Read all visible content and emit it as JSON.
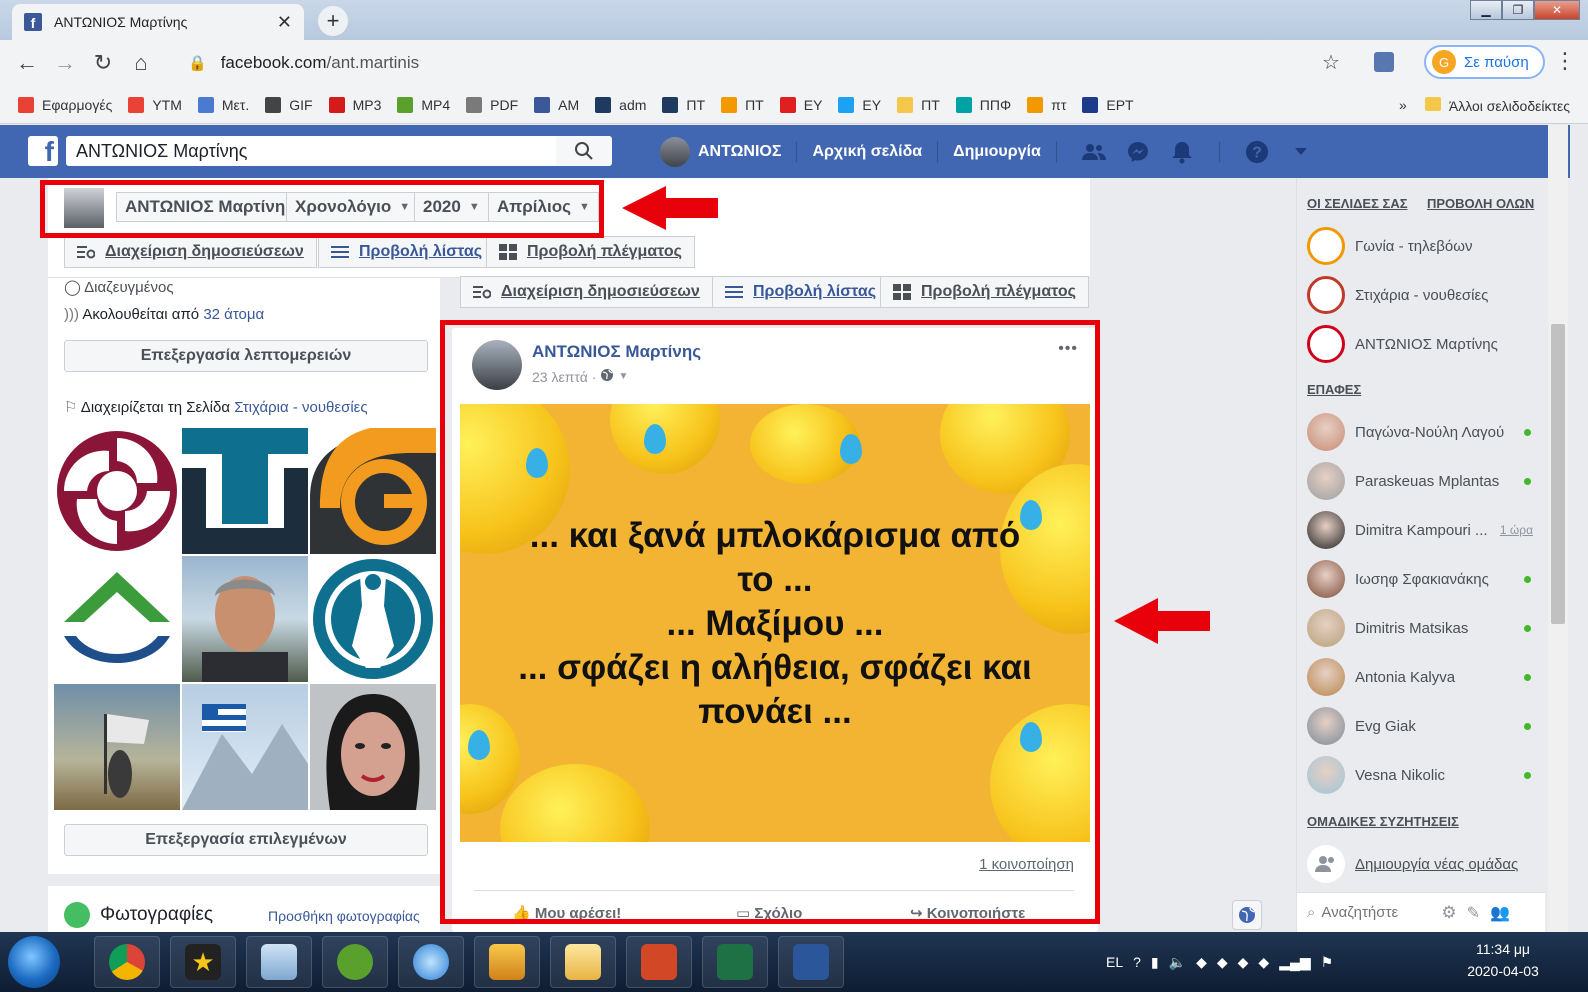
{
  "browser": {
    "tab_title": "ΑΝΤΩΝΙΟΣ Μαρτίνης",
    "url_host": "facebook.com",
    "url_path": "/ant.martinis",
    "profile_status": "Σε παύση",
    "bookmarks": [
      {
        "label": "Εφαρμογές",
        "color": "#e94235"
      },
      {
        "label": "YTM",
        "color": "#ea4335"
      },
      {
        "label": "Μετ.",
        "color": "#4a7bd0"
      },
      {
        "label": "GIF",
        "color": "#444444"
      },
      {
        "label": "MP3",
        "color": "#d41a1a"
      },
      {
        "label": "MP4",
        "color": "#5aa02c"
      },
      {
        "label": "PDF",
        "color": "#7a7a7a"
      },
      {
        "label": "AM",
        "color": "#3b5998"
      },
      {
        "label": "adm",
        "color": "#1e3a5f"
      },
      {
        "label": "ΠΤ",
        "color": "#1e3a5f"
      },
      {
        "label": "ΠΤ",
        "color": "#f29900"
      },
      {
        "label": "ΕΥ",
        "color": "#e02020"
      },
      {
        "label": "ΕΥ",
        "color": "#1da1f2"
      },
      {
        "label": "ΠΤ",
        "color": "#f3c84b"
      },
      {
        "label": "ΠΠΦ",
        "color": "#00a3a3"
      },
      {
        "label": "πτ",
        "color": "#f29900"
      },
      {
        "label": "ΕΡΤ",
        "color": "#1e3a8a"
      }
    ],
    "bookmarks_more": "»",
    "other_bookmarks": "Άλλοι σελιδοδείκτες"
  },
  "fb": {
    "search_value": "ΑΝΤΩΝΙΟΣ Μαρτίνης",
    "user_name": "ΑΝΤΩΝΙΟΣ",
    "home": "Αρχική σελίδα",
    "create": "Δημιουργία"
  },
  "timeline_header": {
    "name": "ΑΝΤΩΝΙΟΣ Μαρτίνης",
    "timeline": "Χρονολόγιο",
    "year": "2020",
    "month": "Απρίλιος",
    "manage_posts": "Διαχείριση δημοσιεύσεων",
    "list_view": "Προβολή λίστας",
    "grid_view": "Προβολή πλέγματος"
  },
  "left": {
    "status": "Διαζευγμένος",
    "followed_prefix": "Ακολουθείται από",
    "followed_link": "32 άτομα",
    "edit_details": "Επεξεργασία λεπτομερειών",
    "manages_prefix": "Διαχειρίζεται τη Σελίδα",
    "manages_link": "Στιχάρια - νουθεσίες",
    "edit_selected": "Επεξεργασία επιλεγμένων",
    "photos_title": "Φωτογραφίες",
    "add_photo": "Προσθήκη φωτογραφίας"
  },
  "post": {
    "author": "ΑΝΤΩΝΙΟΣ Μαρτίνης",
    "time": "23 λεπτά",
    "image_text_lines": [
      "... και ξανά μπλοκάρισμα από",
      "το ...",
      "... Μαξίμου ...",
      "... σφάζει η αλήθεια, σφάζει και",
      "πονάει ..."
    ],
    "shares": "1 κοινοποίηση",
    "like": "Μου αρέσει!",
    "comment": "Σχόλιο",
    "share": "Κοινοποιήστε",
    "more": "•••"
  },
  "sidebar": {
    "pages_header": "ΟΙ ΣΕΛΙΔΕΣ ΣΑΣ",
    "see_all": "ΠΡΟΒΟΛΗ ΟΛΩΝ",
    "pages": [
      {
        "name": "Γωνία - τηλεβόων",
        "color": "#f29900"
      },
      {
        "name": "Στιχάρια - νουθεσίες",
        "color": "#c0392b"
      },
      {
        "name": "ΑΝΤΩΝΙΟΣ Μαρτίνης",
        "color": "#d0021b"
      }
    ],
    "contacts_header": "ΕΠΑΦΕΣ",
    "contacts": [
      {
        "name": "Παγώνα-Νούλη Λαγού",
        "online": true,
        "time": ""
      },
      {
        "name": "Paraskeuas Mplantas",
        "online": true,
        "time": ""
      },
      {
        "name": "Dimitra Kampouri ...",
        "online": false,
        "time": "1 ώρα"
      },
      {
        "name": "Ιωσηφ Σφακιανάκης",
        "online": true,
        "time": ""
      },
      {
        "name": "Dimitris Matsikas",
        "online": true,
        "time": ""
      },
      {
        "name": "Antonia Kalyva",
        "online": true,
        "time": ""
      },
      {
        "name": "Evg Giak",
        "online": true,
        "time": ""
      },
      {
        "name": "Vesna Nikolic",
        "online": true,
        "time": ""
      }
    ],
    "group_header": "ΟΜΑΔΙΚΕΣ ΣΥΖΗΤΗΣΕΙΣ",
    "new_group": "Δημιουργία νέας ομάδας",
    "search_placeholder": "Αναζητήστε"
  },
  "taskbar": {
    "lang": "EL",
    "time": "11:34 μμ",
    "date": "2020-04-03"
  }
}
